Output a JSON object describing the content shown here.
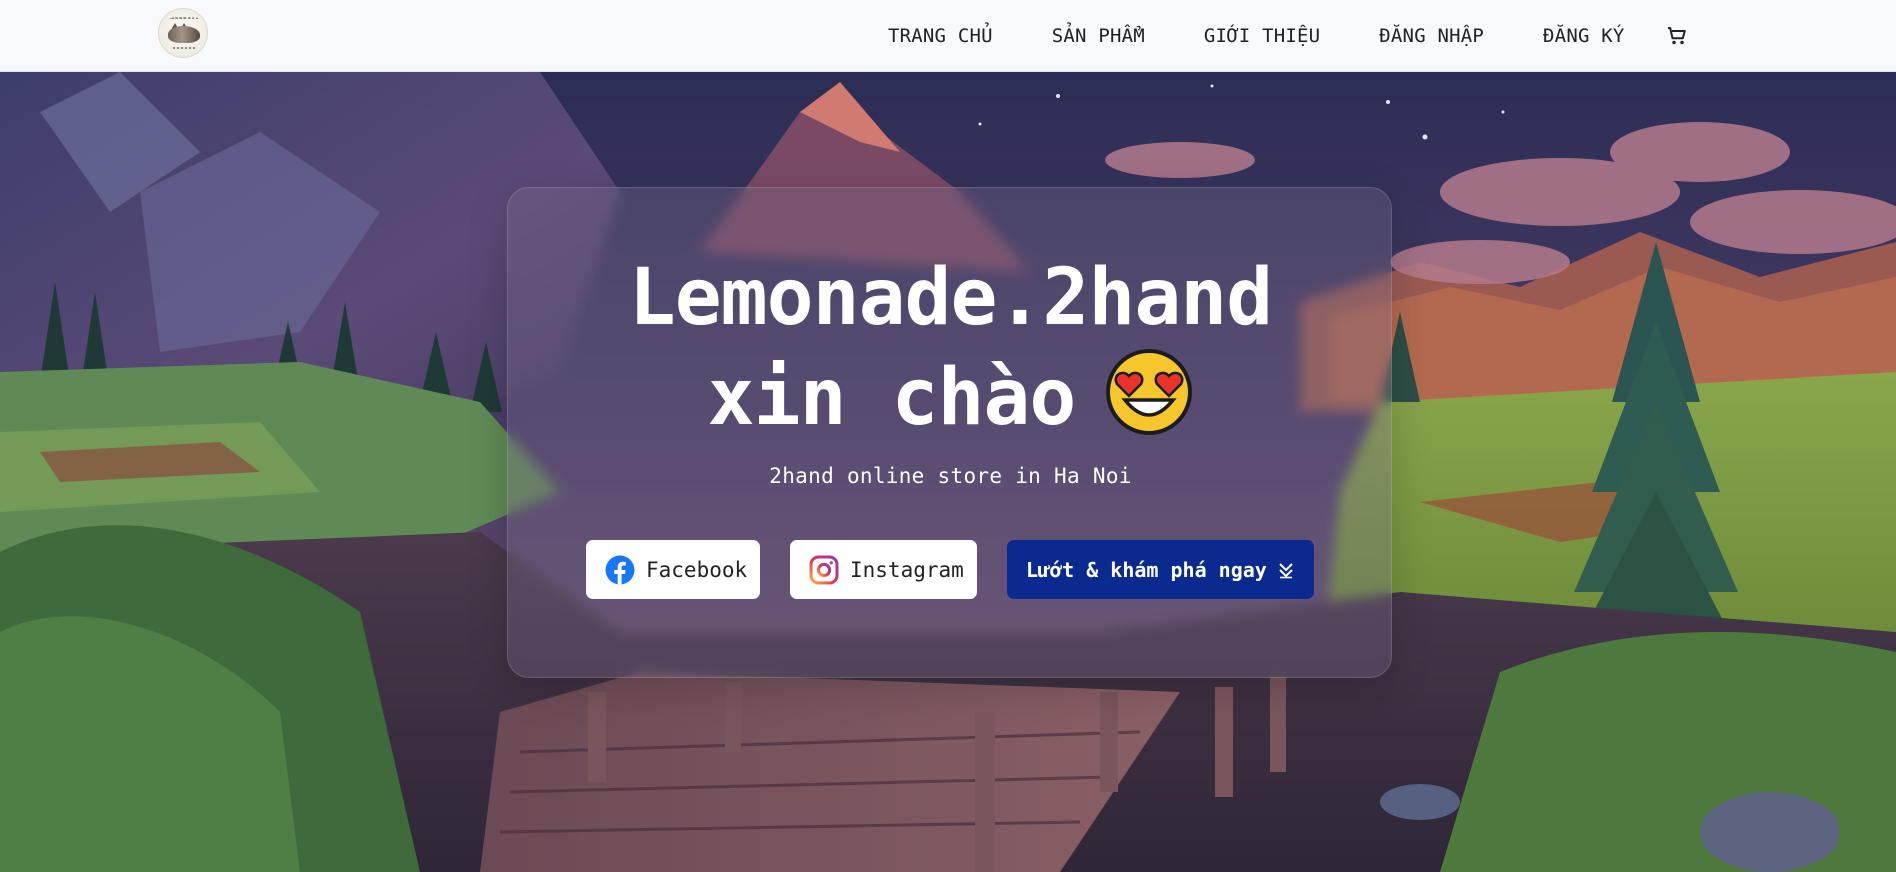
{
  "nav": {
    "logo_icon": "cat-logo-icon",
    "items": [
      {
        "label": "TRANG CHỦ"
      },
      {
        "label": "SẢN PHẨM"
      },
      {
        "label": "GIỚI THIỆU"
      },
      {
        "label": "ĐĂNG NHẬP"
      },
      {
        "label": "ĐĂNG KÝ"
      }
    ],
    "cart_icon": "shopping-cart-icon"
  },
  "hero": {
    "title_line1": "Lemonade.2hand",
    "title_line2": "xin chào",
    "emoji_icon": "heart-eyes-emoji-icon",
    "subtitle": "2hand online store in Ha Noi",
    "buttons": {
      "facebook": {
        "label": "Facebook",
        "icon": "facebook-icon"
      },
      "instagram": {
        "label": "Instagram",
        "icon": "instagram-icon"
      },
      "explore": {
        "label": "Lướt & khám phá ngay",
        "icon": "double-chevron-down-icon"
      }
    }
  },
  "colors": {
    "navbar_bg": "#f8f9fc",
    "explore_button_bg": "#0b2a8f",
    "facebook_blue": "#1877f2"
  }
}
